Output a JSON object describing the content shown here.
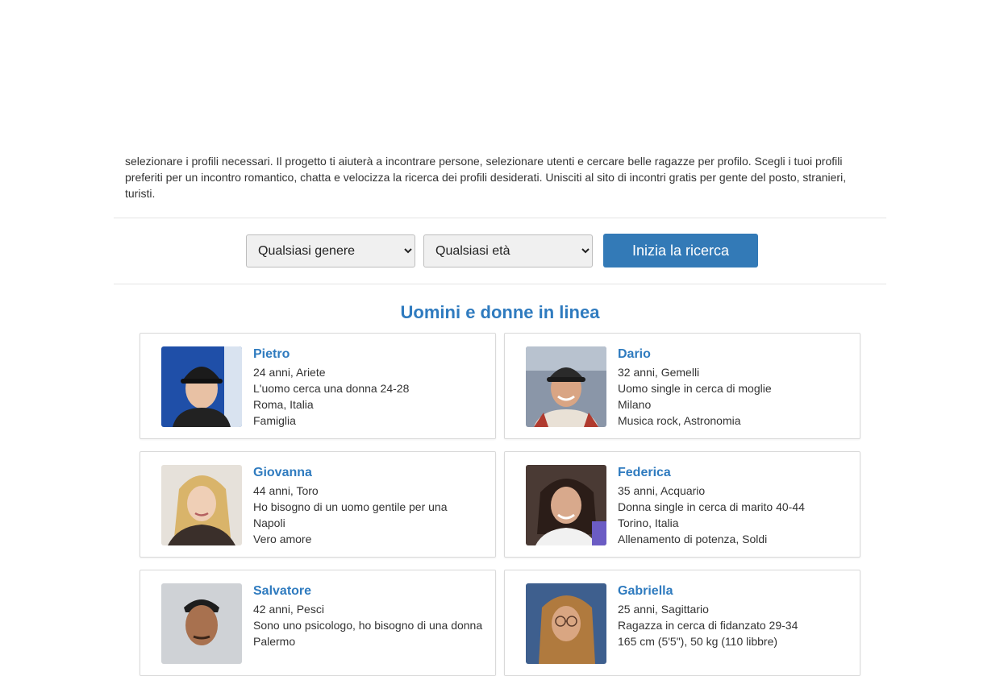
{
  "intro": {
    "lines": [
      "selezionare i profili necessari. Il progetto ti aiuterà a incontrare persone, selezionare utenti e cercare belle ragazze per profilo. Scegli i tuoi profili",
      "preferiti per un incontro romantico, chatta e velocizza la ricerca dei profili desiderati. Unisciti al sito di incontri gratis per gente del posto, stranieri,",
      "turisti."
    ]
  },
  "search": {
    "gender_selected": "Qualsiasi genere",
    "age_selected": "Qualsiasi età",
    "button_label": "Inizia la ricerca"
  },
  "section": {
    "title": "Uomini e donne in linea"
  },
  "profiles": [
    {
      "name": "Pietro",
      "age_sign": "24 anni, Ariete",
      "seeking": "L'uomo cerca una donna 24-28",
      "location": "Roma, Italia",
      "interests": "Famiglia",
      "photo": "man-cap-portrait"
    },
    {
      "name": "Dario",
      "age_sign": "32 anni, Gemelli",
      "seeking": "Uomo single in cerca di moglie",
      "location": "Milano",
      "interests": "Musica rock, Astronomia",
      "photo": "man-cap-smiling-portrait"
    },
    {
      "name": "Giovanna",
      "age_sign": "44 anni, Toro",
      "seeking": "Ho bisogno di un uomo gentile per una",
      "location": "Napoli",
      "interests": "Vero amore",
      "photo": "blonde-woman-portrait"
    },
    {
      "name": "Federica",
      "age_sign": "35 anni, Acquario",
      "seeking": "Donna single in cerca di marito 40-44",
      "location": "Torino, Italia",
      "interests": "Allenamento di potenza, Soldi",
      "photo": "brunette-woman-portrait"
    },
    {
      "name": "Salvatore",
      "age_sign": "42 anni, Pesci",
      "seeking": "Sono uno psicologo, ho bisogno di una donna",
      "location": "Palermo",
      "interests": "",
      "photo": "man-portrait"
    },
    {
      "name": "Gabriella",
      "age_sign": "25 anni, Sagittario",
      "seeking": "Ragazza in cerca di fidanzato 29-34",
      "location": "165 cm (5'5\"), 50 kg (110 libbre)",
      "interests": "",
      "photo": "woman-glasses-portrait"
    }
  ]
}
